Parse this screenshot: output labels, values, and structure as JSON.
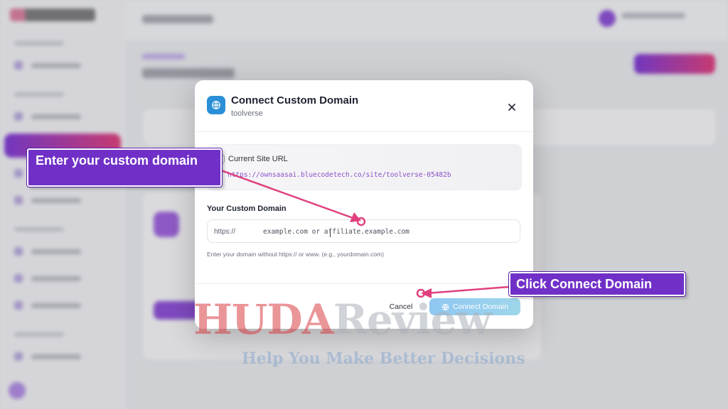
{
  "modal": {
    "title": "Connect Custom Domain",
    "subtitle": "toolverse",
    "globe_icon": "globe-icon",
    "close_icon": "close-icon",
    "current_site": {
      "label": "Current Site URL",
      "value": "https://ownsaasai.bluecodetech.co/site/toolverse-05482b"
    },
    "custom_domain": {
      "label": "Your Custom Domain",
      "prefix": "https://",
      "placeholder": "example.com or affiliate.example.com",
      "value": "",
      "help": "Enter your domain without https:// or www. (e.g., yourdomain.com)"
    },
    "footer": {
      "cancel_label": "Cancel",
      "connect_label": "Connect Domain"
    }
  },
  "annotations": {
    "callout_1": "Enter your custom domain",
    "callout_2": "Click Connect Domain",
    "accent_color": "#7030c8",
    "arrow_color": "#e0407e"
  },
  "watermark": {
    "part_a": "HUDA",
    "part_b": "Review",
    "tagline": "Help You Make Better Decisions"
  }
}
